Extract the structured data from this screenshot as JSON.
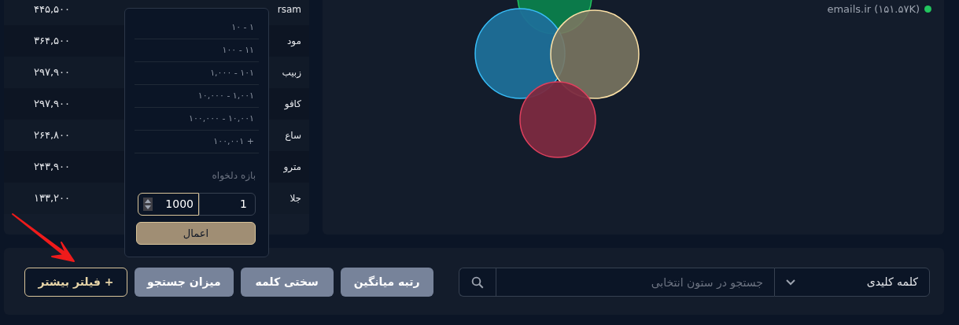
{
  "table": {
    "rows": [
      {
        "keyword": "rsam",
        "value": "۴۴۵,۵۰۰"
      },
      {
        "keyword": "مود",
        "value": "۳۶۴,۵۰۰"
      },
      {
        "keyword": "زبیب",
        "value": "۲۹۷,۹۰۰"
      },
      {
        "keyword": "کافو",
        "value": "۲۹۷,۹۰۰"
      },
      {
        "keyword": "ساع",
        "value": "۲۶۴,۸۰۰"
      },
      {
        "keyword": "مترو",
        "value": "۲۴۳,۹۰۰"
      },
      {
        "keyword": "جلا",
        "value": "۱۳۳,۲۰۰"
      }
    ]
  },
  "venn": {
    "legend": [
      {
        "label": "emails.ir (۱۵۱.۵۷K)",
        "color": "#22c55e"
      }
    ]
  },
  "range_popover": {
    "options": [
      "۱ - ۱۰",
      "۱۱ - ۱۰۰",
      "۱۰۱ - ۱,۰۰۰",
      "۱,۰۰۱ - ۱۰,۰۰۰",
      "۱۰,۰۰۱ - ۱۰۰,۰۰۰",
      "+ ۱۰۰,۰۰۱"
    ],
    "custom_label": "بازه دلخواه",
    "from": "1",
    "to": "1000",
    "apply": "اعمال"
  },
  "search_bar": {
    "column": "کلمه کلیدی",
    "placeholder": "جستجو در ستون انتخابی"
  },
  "filters": [
    "رتبه میانگین",
    "سختی کلمه",
    "میزان جستجو"
  ],
  "more_filters": "+ فیلتر بیشتر"
}
